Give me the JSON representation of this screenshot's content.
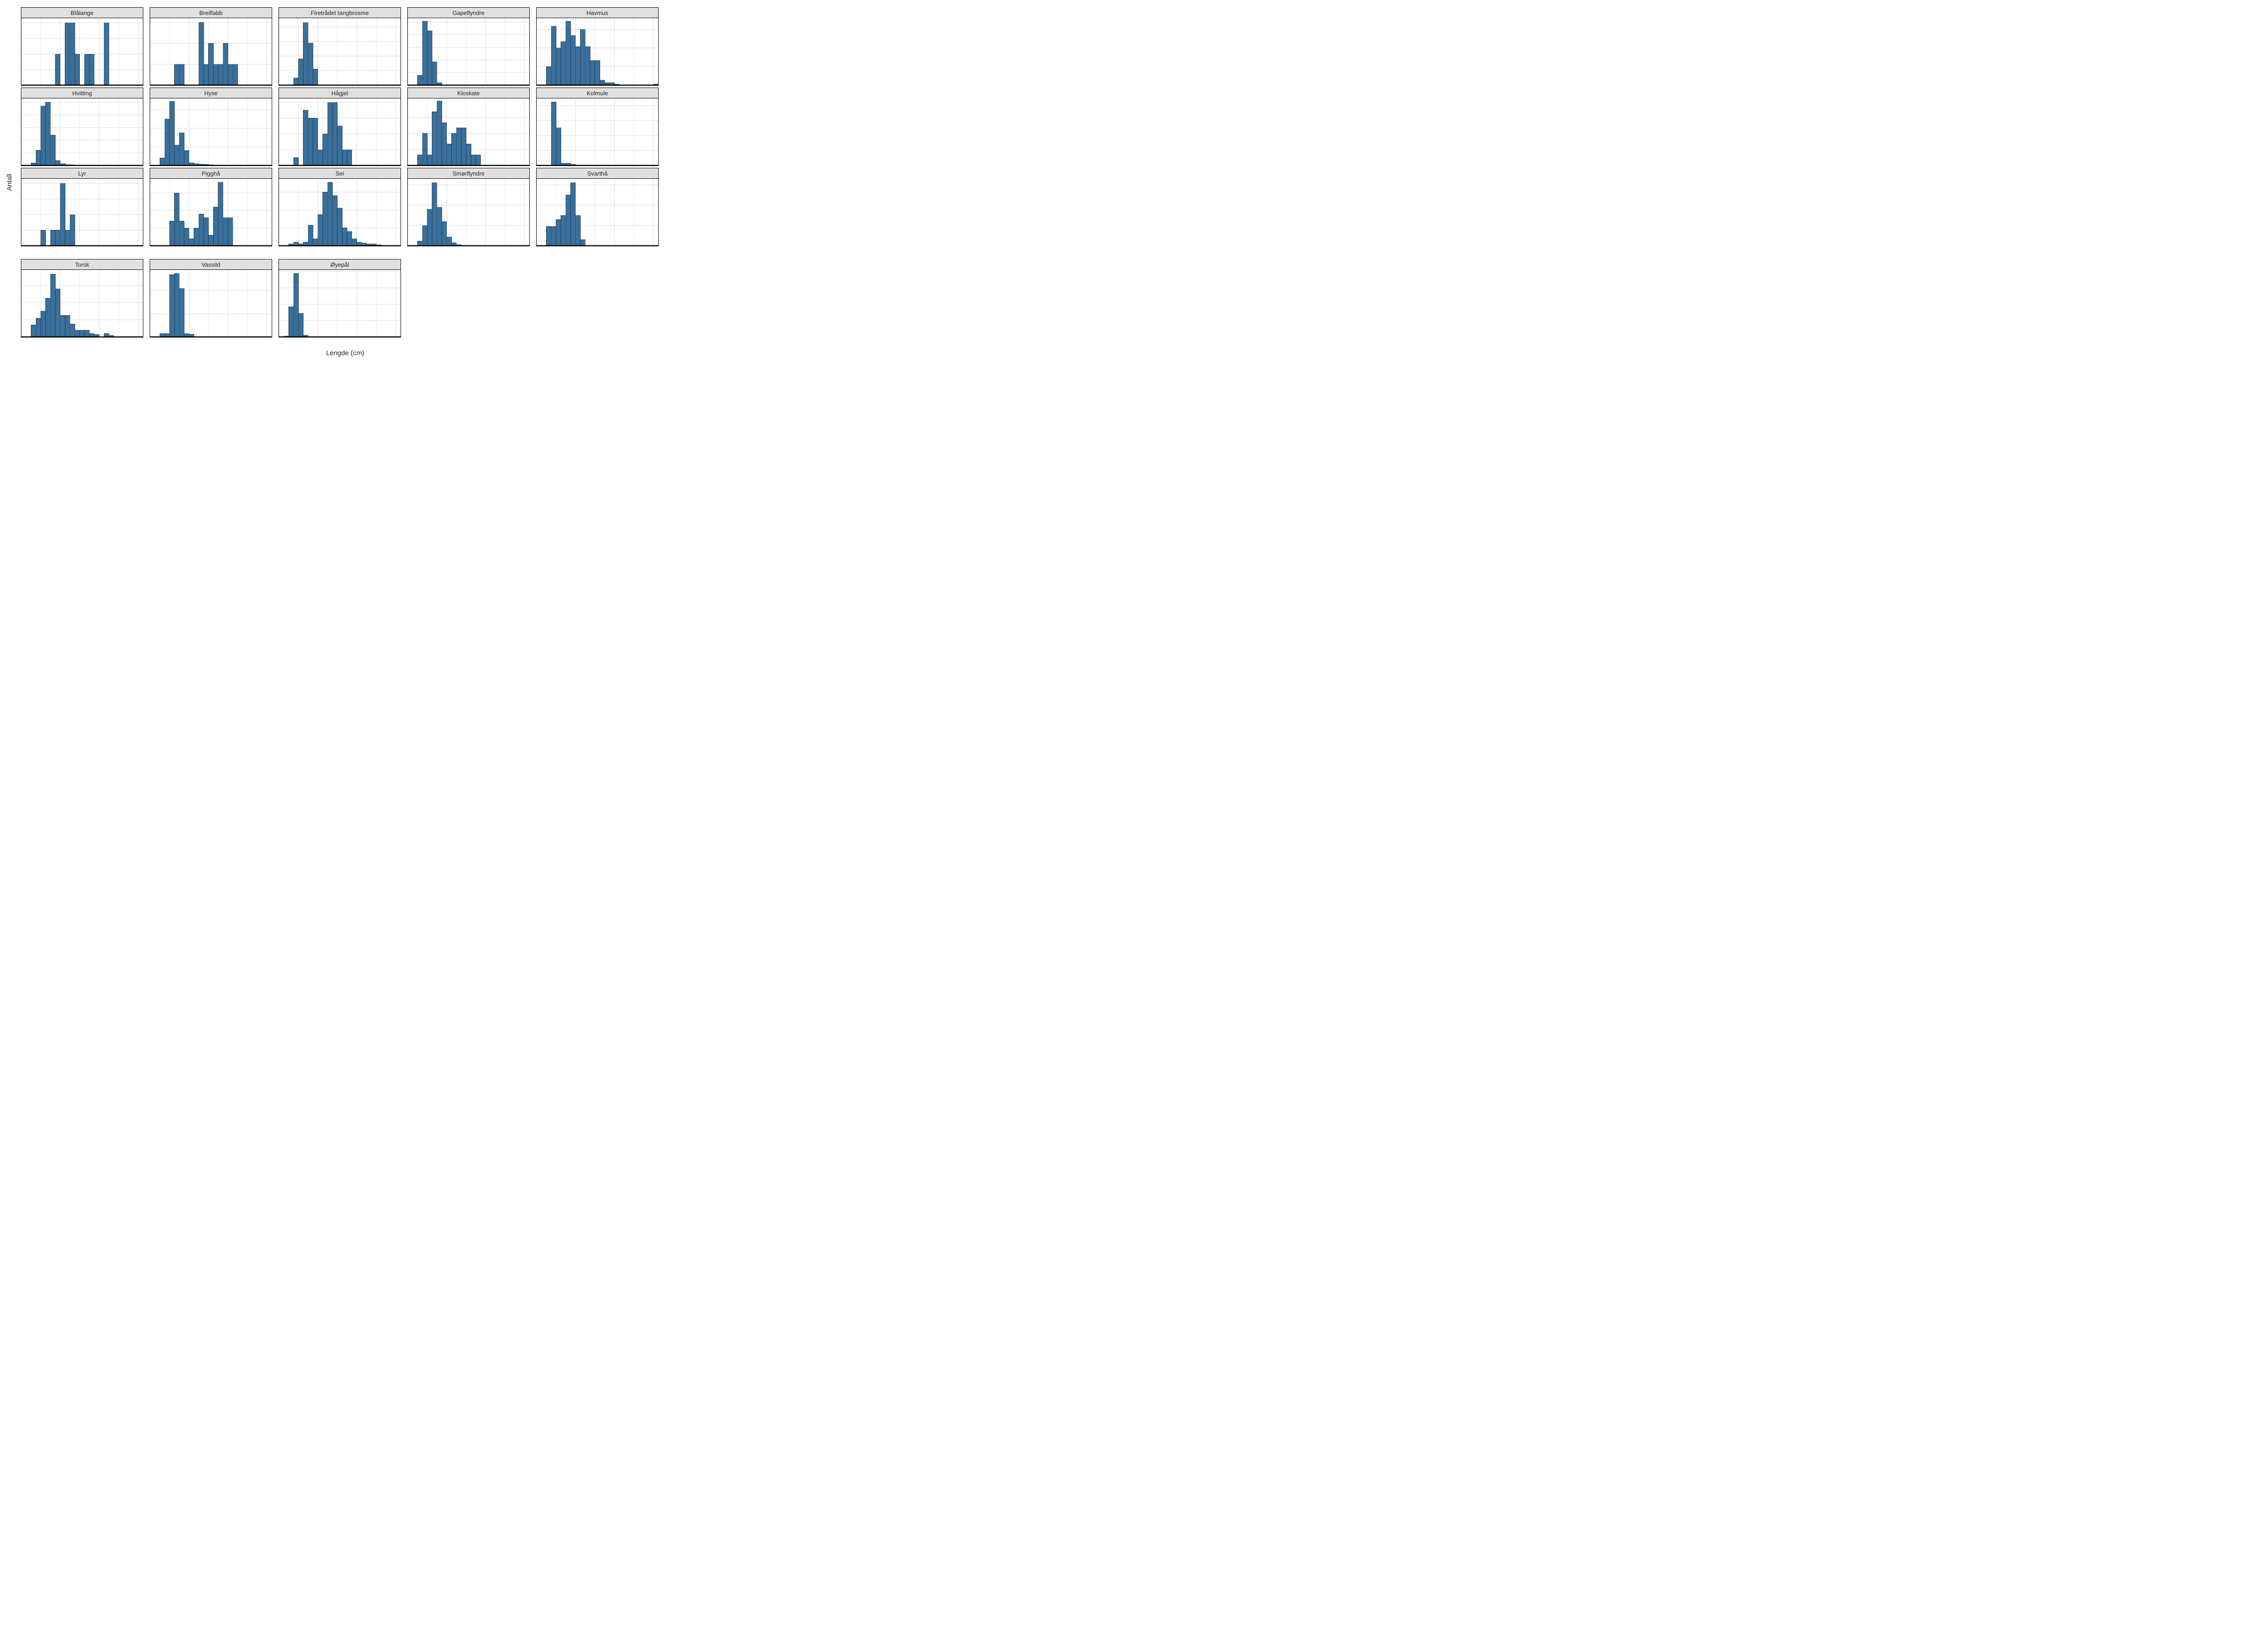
{
  "ylabel": "Antall",
  "xlabel": "Lengde (cm)",
  "x": {
    "min": 0,
    "max": 125,
    "ticks": [
      0,
      40,
      80,
      120
    ],
    "minor": [
      20,
      60,
      100
    ]
  },
  "bin_width": 5,
  "chart_data": [
    {
      "type": "bar",
      "title": "Blålange",
      "ymax": 2.15,
      "yticks": [
        0.0,
        0.5,
        1.0,
        1.5,
        2.0
      ],
      "bins": [
        [
          35,
          1
        ],
        [
          45,
          2
        ],
        [
          50,
          2
        ],
        [
          55,
          1
        ],
        [
          65,
          1
        ],
        [
          70,
          1
        ],
        [
          85,
          2
        ]
      ]
    },
    {
      "type": "bar",
      "title": "Breiflabb",
      "ymax": 3.2,
      "yticks": [
        0,
        1,
        2,
        3
      ],
      "bins": [
        [
          25,
          1
        ],
        [
          30,
          1
        ],
        [
          50,
          3
        ],
        [
          55,
          1
        ],
        [
          60,
          2
        ],
        [
          65,
          1
        ],
        [
          70,
          1
        ],
        [
          75,
          2
        ],
        [
          80,
          1
        ],
        [
          85,
          1
        ]
      ]
    },
    {
      "type": "bar",
      "title": "Firetrådet tangbrosme",
      "ymax": 46,
      "yticks": [
        0,
        10,
        20,
        30,
        40
      ],
      "bins": [
        [
          15,
          5
        ],
        [
          20,
          18
        ],
        [
          25,
          43
        ],
        [
          30,
          29
        ],
        [
          35,
          11
        ]
      ]
    },
    {
      "type": "bar",
      "title": "Gapeflyndre",
      "ymax": 530,
      "yticks": [
        0,
        100,
        200,
        300,
        400,
        500
      ],
      "bins": [
        [
          10,
          80
        ],
        [
          15,
          505
        ],
        [
          20,
          430
        ],
        [
          25,
          185
        ],
        [
          30,
          20
        ]
      ]
    },
    {
      "type": "bar",
      "title": "Havmus",
      "ymax": 108,
      "yticks": [
        0,
        30,
        60,
        90
      ],
      "bins": [
        [
          10,
          30
        ],
        [
          15,
          95
        ],
        [
          20,
          60
        ],
        [
          25,
          70
        ],
        [
          30,
          103
        ],
        [
          35,
          80
        ],
        [
          40,
          62
        ],
        [
          45,
          90
        ],
        [
          50,
          62
        ],
        [
          55,
          40
        ],
        [
          60,
          40
        ],
        [
          65,
          8
        ],
        [
          70,
          4
        ],
        [
          75,
          4
        ],
        [
          80,
          2
        ],
        [
          120,
          2
        ]
      ]
    },
    {
      "type": "bar",
      "title": "Hvitting",
      "ymax": 530,
      "yticks": [
        0,
        100,
        200,
        300,
        400,
        500
      ],
      "bins": [
        [
          10,
          20
        ],
        [
          15,
          120
        ],
        [
          20,
          470
        ],
        [
          25,
          500
        ],
        [
          30,
          240
        ],
        [
          35,
          40
        ],
        [
          40,
          15
        ],
        [
          45,
          8
        ],
        [
          50,
          5
        ]
      ]
    },
    {
      "type": "bar",
      "title": "Hyse",
      "ymax": 360,
      "yticks": [
        0,
        100,
        200,
        300
      ],
      "bins": [
        [
          10,
          40
        ],
        [
          15,
          250
        ],
        [
          20,
          345
        ],
        [
          25,
          110
        ],
        [
          30,
          175
        ],
        [
          35,
          80
        ],
        [
          40,
          15
        ],
        [
          45,
          10
        ],
        [
          50,
          8
        ],
        [
          55,
          6
        ],
        [
          60,
          4
        ],
        [
          65,
          3
        ],
        [
          70,
          2
        ]
      ]
    },
    {
      "type": "bar",
      "title": "Hågjel",
      "ymax": 8.5,
      "yticks": [
        0,
        2,
        4,
        6,
        8
      ],
      "bins": [
        [
          15,
          1
        ],
        [
          25,
          7
        ],
        [
          30,
          6
        ],
        [
          35,
          6
        ],
        [
          40,
          2
        ],
        [
          45,
          4
        ],
        [
          50,
          8
        ],
        [
          55,
          8
        ],
        [
          60,
          5
        ],
        [
          65,
          2
        ],
        [
          70,
          2
        ]
      ]
    },
    {
      "type": "bar",
      "title": "Kloskate",
      "ymax": 12.5,
      "yticks": [
        0,
        3,
        6,
        9
      ],
      "bins": [
        [
          10,
          2
        ],
        [
          15,
          6
        ],
        [
          20,
          2
        ],
        [
          25,
          10
        ],
        [
          30,
          12
        ],
        [
          35,
          8
        ],
        [
          40,
          4
        ],
        [
          45,
          6
        ],
        [
          50,
          7
        ],
        [
          55,
          7
        ],
        [
          60,
          4
        ],
        [
          65,
          2
        ],
        [
          70,
          2
        ]
      ]
    },
    {
      "type": "bar",
      "title": "Kolmule",
      "ymax": 1120,
      "yticks": [
        0,
        250,
        500,
        750,
        1000
      ],
      "bins": [
        [
          15,
          1060
        ],
        [
          20,
          630
        ],
        [
          25,
          40
        ],
        [
          30,
          40
        ],
        [
          35,
          20
        ]
      ]
    },
    {
      "type": "bar",
      "title": "Lyr",
      "ymax": 4.3,
      "yticks": [
        0,
        1,
        2,
        3,
        4
      ],
      "bins": [
        [
          20,
          1
        ],
        [
          30,
          1
        ],
        [
          35,
          1
        ],
        [
          40,
          4
        ],
        [
          45,
          1
        ],
        [
          50,
          2
        ]
      ]
    },
    {
      "type": "bar",
      "title": "Pigghå",
      "ymax": 19,
      "yticks": [
        0,
        5,
        10,
        15
      ],
      "bins": [
        [
          20,
          7
        ],
        [
          25,
          15
        ],
        [
          30,
          7
        ],
        [
          35,
          5
        ],
        [
          40,
          2
        ],
        [
          45,
          5
        ],
        [
          50,
          9
        ],
        [
          55,
          8
        ],
        [
          60,
          3
        ],
        [
          65,
          11
        ],
        [
          70,
          18
        ],
        [
          75,
          8
        ],
        [
          80,
          8
        ]
      ]
    },
    {
      "type": "bar",
      "title": "Sei",
      "ymax": 75,
      "yticks": [
        0,
        20,
        40,
        60
      ],
      "bins": [
        [
          10,
          2
        ],
        [
          15,
          4
        ],
        [
          20,
          2
        ],
        [
          25,
          4
        ],
        [
          30,
          23
        ],
        [
          35,
          8
        ],
        [
          40,
          35
        ],
        [
          45,
          60
        ],
        [
          50,
          71
        ],
        [
          55,
          56
        ],
        [
          60,
          42
        ],
        [
          65,
          20
        ],
        [
          70,
          16
        ],
        [
          75,
          8
        ],
        [
          80,
          4
        ],
        [
          85,
          3
        ],
        [
          90,
          2
        ],
        [
          95,
          2
        ],
        [
          100,
          1
        ]
      ]
    },
    {
      "type": "bar",
      "title": "Smørflyndre",
      "ymax": 165,
      "yticks": [
        0,
        50,
        100,
        150
      ],
      "bins": [
        [
          10,
          12
        ],
        [
          15,
          50
        ],
        [
          20,
          90
        ],
        [
          25,
          155
        ],
        [
          30,
          95
        ],
        [
          35,
          60
        ],
        [
          40,
          22
        ],
        [
          45,
          8
        ],
        [
          50,
          3
        ]
      ],
      "last_col": true
    },
    {
      "type": "bar",
      "title": "Svarthå",
      "ymax": 330,
      "yticks": [
        0,
        100,
        200,
        300
      ],
      "bins": [
        [
          10,
          95
        ],
        [
          15,
          95
        ],
        [
          20,
          130
        ],
        [
          25,
          150
        ],
        [
          30,
          250
        ],
        [
          35,
          310
        ],
        [
          40,
          150
        ],
        [
          45,
          30
        ]
      ],
      "last_col": true
    },
    {
      "type": "bar",
      "title": "Torsk",
      "ymax": 78,
      "yticks": [
        0,
        20,
        40,
        60
      ],
      "bins": [
        [
          10,
          14
        ],
        [
          15,
          22
        ],
        [
          20,
          30
        ],
        [
          25,
          45
        ],
        [
          30,
          73
        ],
        [
          35,
          56
        ],
        [
          40,
          25
        ],
        [
          45,
          25
        ],
        [
          50,
          15
        ],
        [
          55,
          8
        ],
        [
          60,
          8
        ],
        [
          65,
          8
        ],
        [
          70,
          4
        ],
        [
          75,
          3
        ],
        [
          85,
          4
        ],
        [
          90,
          2
        ]
      ],
      "last_row": true
    },
    {
      "type": "bar",
      "title": "Vassild",
      "ymax": 290,
      "yticks": [
        0,
        100,
        200
      ],
      "bins": [
        [
          10,
          15
        ],
        [
          15,
          15
        ],
        [
          20,
          270
        ],
        [
          25,
          275
        ],
        [
          30,
          210
        ],
        [
          35,
          15
        ],
        [
          40,
          12
        ]
      ],
      "last_row": true
    },
    {
      "type": "bar",
      "title": "Øyepål",
      "ymax": 2050,
      "yticks": [
        0,
        500,
        1000,
        1500,
        2000
      ],
      "bins": [
        [
          5,
          30
        ],
        [
          10,
          920
        ],
        [
          15,
          1940
        ],
        [
          20,
          720
        ],
        [
          25,
          60
        ]
      ],
      "last_row": true
    }
  ]
}
